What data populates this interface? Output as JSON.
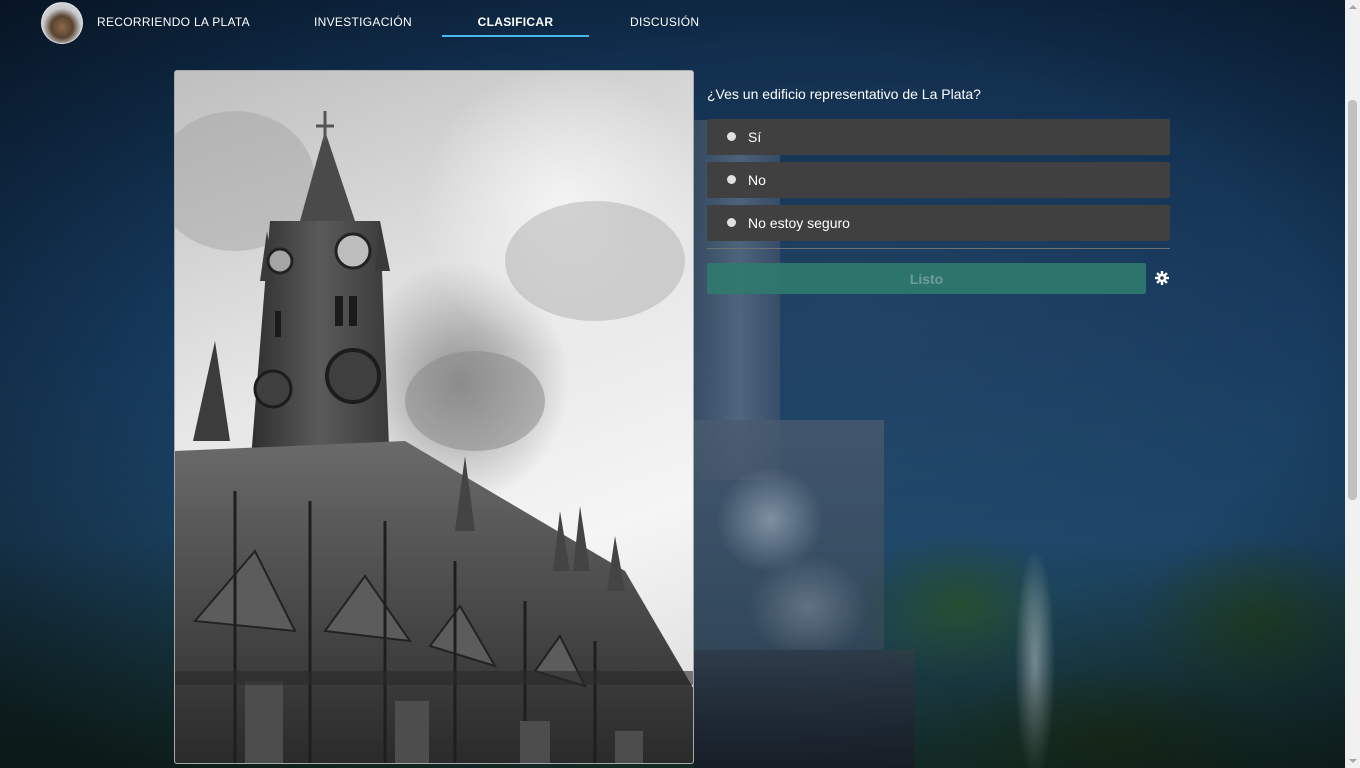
{
  "nav": {
    "brand": "RECORRIENDO LA PLATA",
    "links": [
      {
        "label": "INVESTIGACIÓN",
        "active": false
      },
      {
        "label": "CLASIFICAR",
        "active": true
      },
      {
        "label": "DISCUSIÓN",
        "active": false
      }
    ]
  },
  "task": {
    "question": "¿Ves un edificio representativo de La Plata?",
    "answers": [
      "Sí",
      "No",
      "No estoy seguro"
    ],
    "done_label": "Listo"
  },
  "colors": {
    "accent": "#4ab6ee",
    "answer_bg": "#404040",
    "done_button_bg": "#2f7a6e"
  },
  "icons": {
    "settings": "gear-icon"
  }
}
